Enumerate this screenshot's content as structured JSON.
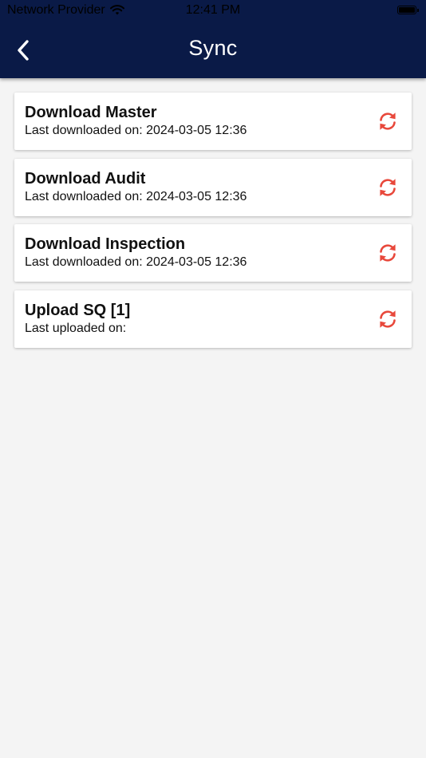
{
  "status_bar": {
    "carrier": "Network Provider",
    "time": "12:41 PM"
  },
  "header": {
    "title": "Sync",
    "background_color": "#0a1a47"
  },
  "sync_items": [
    {
      "title": "Download Master",
      "subtitle": "Last downloaded on: 2024-03-05 12:36",
      "icon": "sync-icon"
    },
    {
      "title": "Download Audit",
      "subtitle": "Last downloaded on: 2024-03-05 12:36",
      "icon": "sync-icon"
    },
    {
      "title": "Download Inspection",
      "subtitle": "Last downloaded on: 2024-03-05 12:36",
      "icon": "sync-icon"
    },
    {
      "title": "Upload SQ [1]",
      "subtitle": "Last uploaded on:",
      "icon": "sync-icon"
    }
  ],
  "colors": {
    "accent": "#e8483b",
    "page_background": "#f4f4f4"
  }
}
